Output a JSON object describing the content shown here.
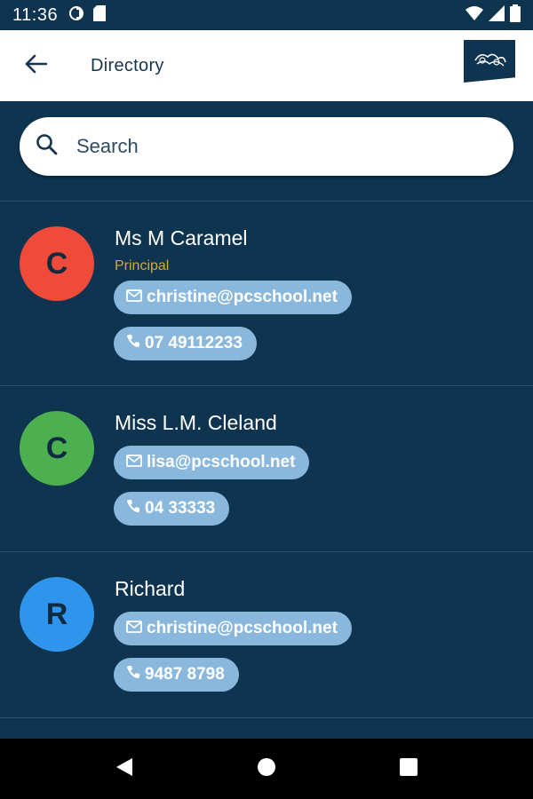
{
  "status_bar": {
    "time": "11:36"
  },
  "app_bar": {
    "title": "Directory"
  },
  "search": {
    "placeholder": "Search"
  },
  "contacts": [
    {
      "initial": "C",
      "avatar_color": "#f04a3a",
      "name": "Ms M Caramel",
      "role": "Principal",
      "email": "christine@pcschool.net",
      "phone": "07 49112233"
    },
    {
      "initial": "C",
      "avatar_color": "#4caf50",
      "name": "Miss L.M. Cleland",
      "email": "lisa@pcschool.net",
      "phone": "04 33333"
    },
    {
      "initial": "R",
      "avatar_color": "#2f95ec",
      "name": "Richard",
      "email": "christine@pcschool.net",
      "phone": "9487 8798"
    }
  ],
  "colors": {
    "background": "#0e3450",
    "chip": "#8ab8dd",
    "role": "#d4a93a"
  }
}
